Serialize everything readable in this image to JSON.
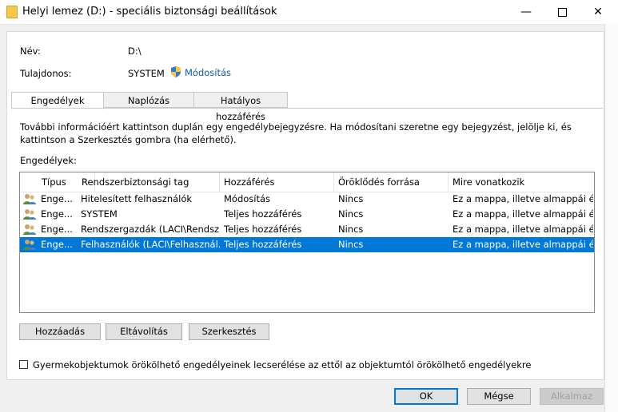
{
  "window": {
    "title": "Helyi lemez (D:) - speciális biztonsági beállítások",
    "min_glyph": "—",
    "close_glyph": "✕"
  },
  "fields": {
    "name_label": "Név:",
    "name_value": "D:\\",
    "owner_label": "Tulajdonos:",
    "owner_value": "SYSTEM",
    "change_link": "Módosítás"
  },
  "tabs": [
    {
      "label": "Engedélyek",
      "active": true
    },
    {
      "label": "Naplózás",
      "active": false
    },
    {
      "label": "Hatályos hozzáférés",
      "active": false
    }
  ],
  "info_text": "További információért kattintson duplán egy engedélybejegyzésre. Ha módosítani szeretne egy bejegyzést, jelölje ki, és kattintson a Szerkesztés gombra (ha elérhető).",
  "permissions_label": "Engedélyek:",
  "table": {
    "columns": [
      "Típus",
      "Rendszerbiztonsági tag",
      "Hozzáférés",
      "Öröklődés forrása",
      "Mire vonatkozik"
    ],
    "rows": [
      [
        "Enge...",
        "Hitelesített felhasználók",
        "Módosítás",
        "Nincs",
        "Ez a mappa, illetve almappái é..."
      ],
      [
        "Enge...",
        "SYSTEM",
        "Teljes hozzáférés",
        "Nincs",
        "Ez a mappa, illetve almappái é..."
      ],
      [
        "Enge...",
        "Rendszergazdák (LACI\\Rendsz...",
        "Teljes hozzáférés",
        "Nincs",
        "Ez a mappa, illetve almappái é..."
      ],
      [
        "Enge...",
        "Felhasználók (LACI\\Felhasznál...",
        "Teljes hozzáférés",
        "Nincs",
        "Ez a mappa, illetve almappái é..."
      ]
    ],
    "selected_row": 3
  },
  "actions": {
    "add": "Hozzáadás",
    "remove": "Eltávolítás",
    "edit": "Szerkesztés"
  },
  "checkbox": {
    "label": "Gyermekobjektumok örökölhető engedélyeinek lecserélése az ettől az objektumtól örökölhető engedélyekre",
    "checked": false
  },
  "footer": {
    "ok": "OK",
    "cancel": "Mégse",
    "apply": "Alkalmaz"
  },
  "colors": {
    "selection": "#0078d7",
    "link": "#0b5cad"
  }
}
